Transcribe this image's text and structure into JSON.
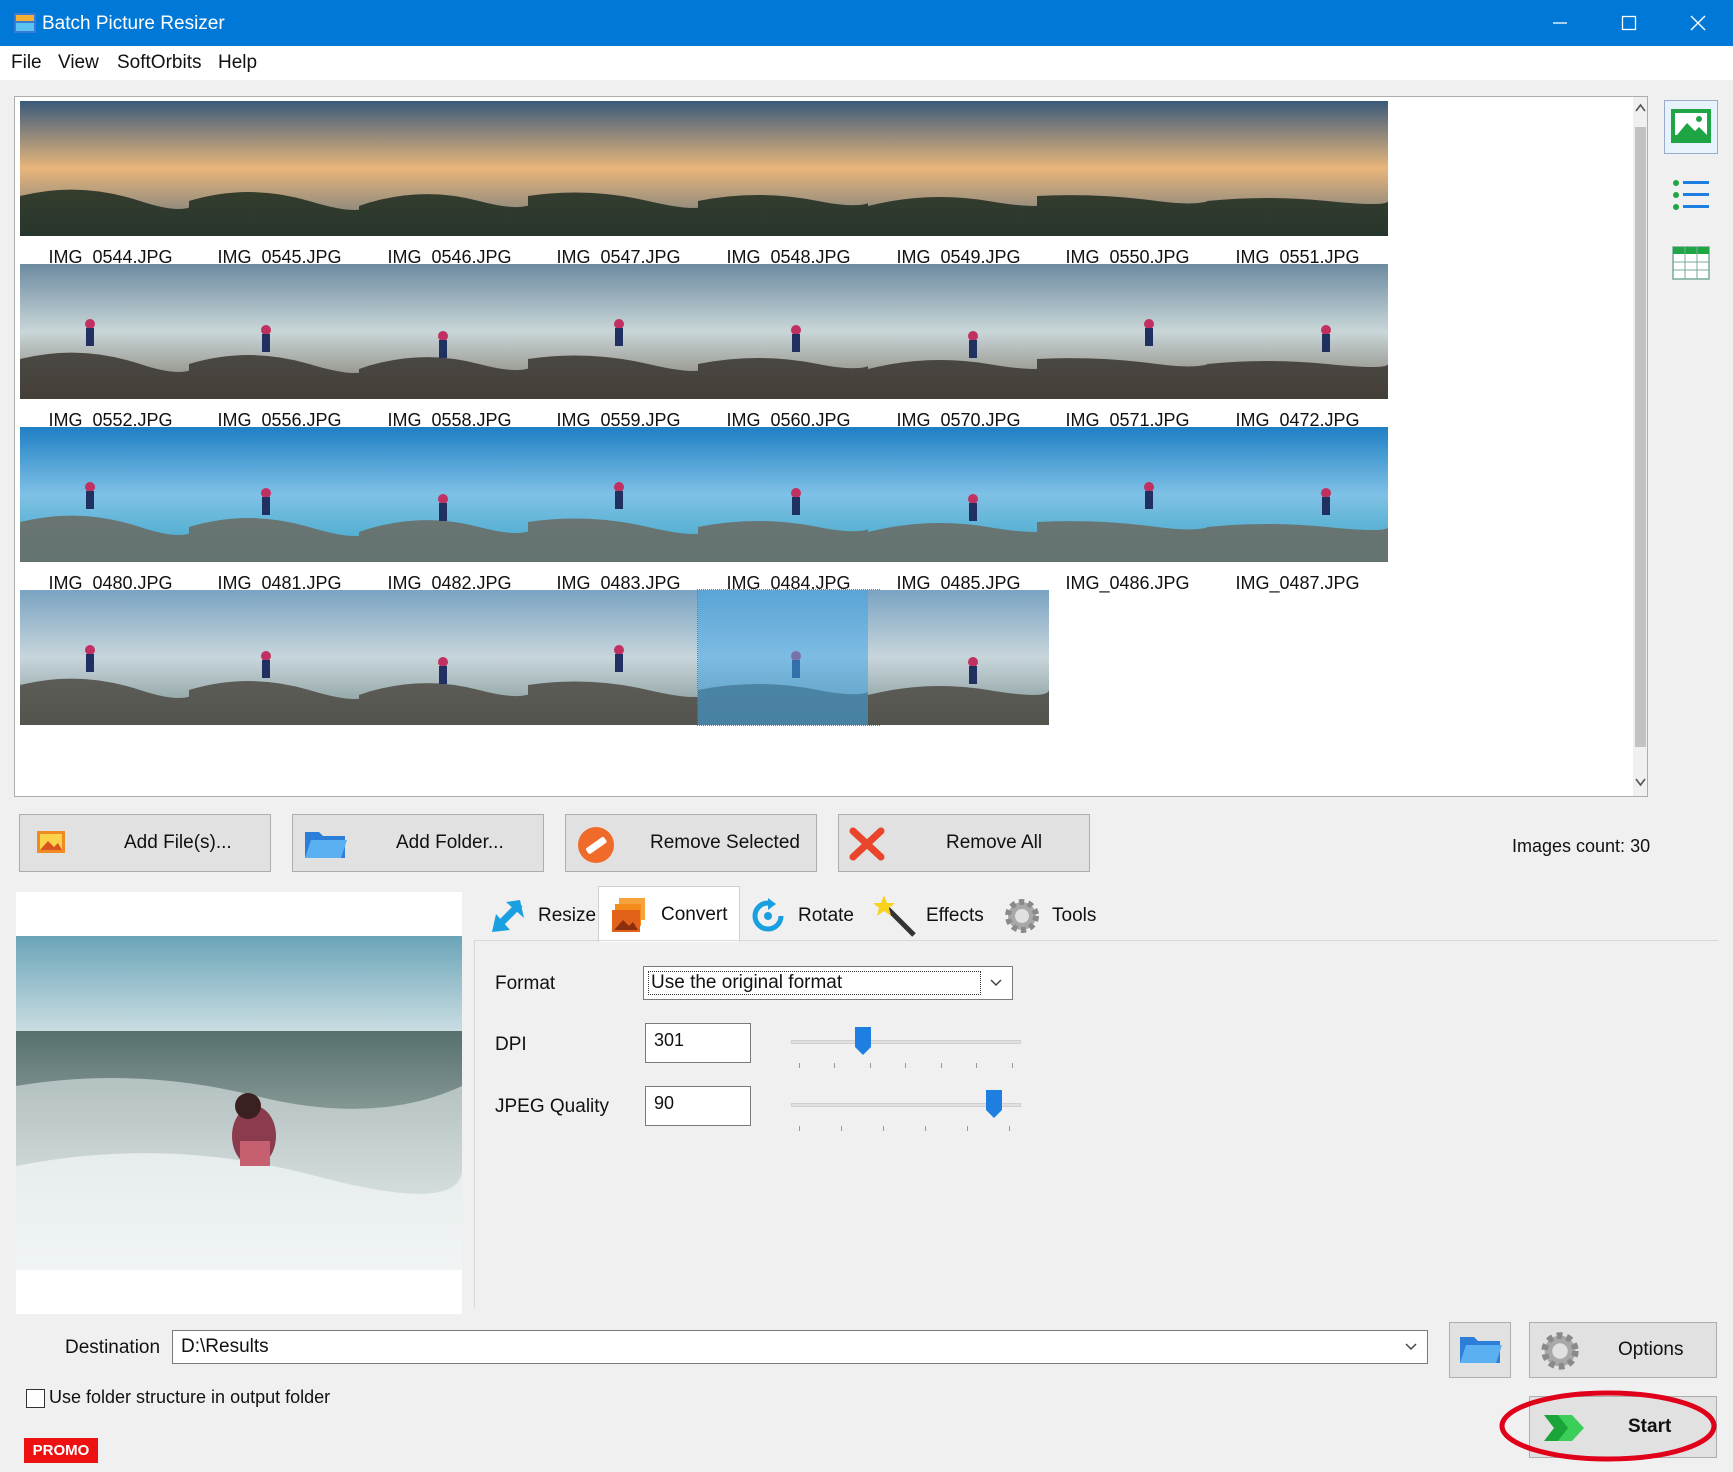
{
  "window": {
    "title": "Batch Picture Resizer"
  },
  "menu": [
    {
      "label": "File"
    },
    {
      "label": "View"
    },
    {
      "label": "SoftOrbits"
    },
    {
      "label": "Help"
    }
  ],
  "gallery": {
    "rows": [
      [
        "IMG_0544.JPG",
        "IMG_0545.JPG",
        "IMG_0546.JPG",
        "IMG_0547.JPG",
        "IMG_0548.JPG",
        "IMG_0549.JPG",
        "IMG_0550.JPG",
        "IMG_0551.JPG"
      ],
      [
        "IMG_0552.JPG",
        "IMG_0556.JPG",
        "IMG_0558.JPG",
        "IMG_0559.JPG",
        "IMG_0560.JPG",
        "IMG_0570.JPG",
        "IMG_0571.JPG",
        "IMG_0472.JPG"
      ],
      [
        "IMG_0480.JPG",
        "IMG_0481.JPG",
        "IMG_0482.JPG",
        "IMG_0483.JPG",
        "IMG_0484.JPG",
        "IMG_0485.JPG",
        "IMG_0486.JPG",
        "IMG_0487.JPG"
      ]
    ],
    "row4_count": 6,
    "selected_index_row4": 4
  },
  "buttons": {
    "add_files": "Add File(s)...",
    "add_folder": "Add Folder...",
    "remove_selected": "Remove Selected",
    "remove_all": "Remove All"
  },
  "images_count": "Images count: 30",
  "tabs": [
    {
      "label": "Resize",
      "icon": "resize-arrow-icon"
    },
    {
      "label": "Convert",
      "icon": "convert-icon"
    },
    {
      "label": "Rotate",
      "icon": "rotate-icon"
    },
    {
      "label": "Effects",
      "icon": "magic-wand-icon"
    },
    {
      "label": "Tools",
      "icon": "gear-icon"
    }
  ],
  "active_tab": "Convert",
  "convert": {
    "format_label": "Format",
    "format_value": "Use the original format",
    "dpi_label": "DPI",
    "dpi_value": "301",
    "jpeg_label": "JPEG Quality",
    "jpeg_value": "90"
  },
  "destination": {
    "label": "Destination",
    "value": "D:\\Results"
  },
  "options_label": "Options",
  "start_label": "Start",
  "use_folder_structure": "Use folder structure in output folder",
  "promo": "PROMO",
  "colors": {
    "titlebar": "#0078d7",
    "accent": "#1e7fe0",
    "start_highlight": "#e0001a"
  }
}
